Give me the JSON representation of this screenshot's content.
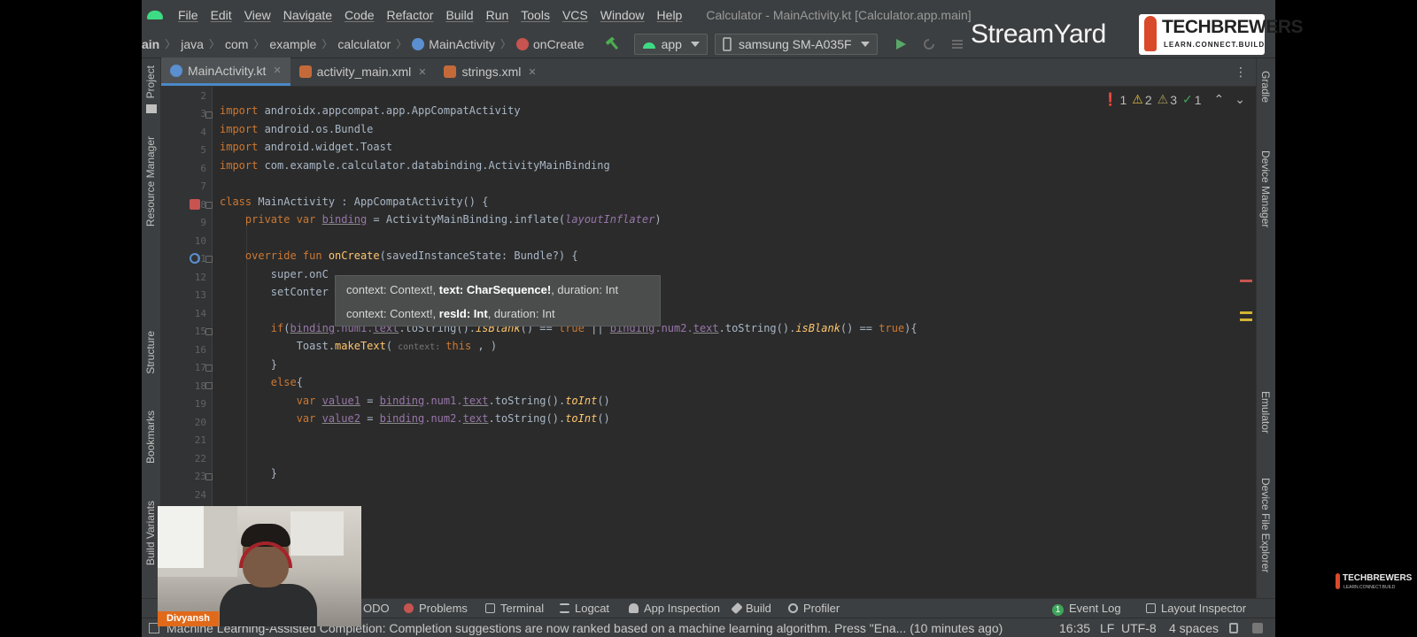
{
  "colors": {
    "ide_bg": "#2b2b2b",
    "toolbar": "#3c3f41",
    "keyword": "#cc7832",
    "function": "#ffc66d",
    "property": "#9876aa",
    "error": "#e05555",
    "warning": "#e8bf3a",
    "accent": "#4a88c7",
    "streamer_badge": "#e06a1a"
  },
  "menu": {
    "items": [
      "File",
      "Edit",
      "View",
      "Navigate",
      "Code",
      "Refactor",
      "Build",
      "Run",
      "Tools",
      "VCS",
      "Window",
      "Help"
    ],
    "window_title": "Calculator - MainActivity.kt [Calculator.app.main]"
  },
  "nav": {
    "breadcrumbs": [
      "ain",
      "java",
      "com",
      "example",
      "calculator",
      "MainActivity",
      "onCreate"
    ],
    "run_config": "app",
    "device": "samsung SM-A035F"
  },
  "tabs": [
    {
      "label": "MainActivity.kt",
      "icon": "kotlin-file-icon"
    },
    {
      "label": "activity_main.xml",
      "icon": "xml-layout-icon"
    },
    {
      "label": "strings.xml",
      "icon": "xml-values-icon"
    }
  ],
  "left_tool_windows": [
    "Project",
    "Resource Manager",
    "Structure",
    "Bookmarks",
    "Build Variants"
  ],
  "right_tool_windows": [
    "Gradle",
    "Device Manager",
    "Emulator",
    "Device File Explorer"
  ],
  "inspections": {
    "errors": "1",
    "warnings": "2",
    "weak_warnings": "3",
    "typos": "1"
  },
  "line_numbers": [
    "2",
    "3",
    "4",
    "5",
    "6",
    "7",
    "8",
    "9",
    "10",
    "11",
    "12",
    "13",
    "14",
    "15",
    "16",
    "17",
    "18",
    "19",
    "20",
    "21",
    "22",
    "23",
    "24"
  ],
  "code": {
    "l3_kw": "import",
    "l3_rest": " androidx.appcompat.app.AppCompatActivity",
    "l4_kw": "import",
    "l4_rest": " android.os.Bundle",
    "l5_kw": "import",
    "l5_rest": " android.widget.Toast",
    "l6_kw": "import",
    "l6_rest": " com.example.calculator.databinding.ActivityMainBinding",
    "l8_kw": "class",
    "l8_rest": " MainActivity : AppCompatActivity() {",
    "l9_kw": "    private var",
    "l9_var": "binding",
    "l9_rest": " = ActivityMainBinding.inflate(",
    "l9_it": "layoutInflater",
    "l9_end": ")",
    "l11_kw": "    override fun",
    "l11_fn": "onCreate",
    "l11_rest": "(savedInstanceState: Bundle?) {",
    "l12": "        super.onC",
    "l13": "        setConter",
    "l15_kw": "        if",
    "l15_a": "(",
    "l15_b": "binding",
    "l15_c": ".num1.",
    "l15_d": "text",
    "l15_e": ".toString().",
    "l15_f": "isBlank",
    "l15_g": "() == ",
    "l15_h": "true",
    "l15_i": " || ",
    "l15_j": "binding",
    "l15_k": ".num2.",
    "l15_l": "text",
    "l15_m": ".toString().",
    "l15_n": "isBlank",
    "l15_o": "() == ",
    "l15_p": "true",
    "l15_q": "){",
    "l16_a": "            Toast.",
    "l16_b": "makeText",
    "l16_c": "(",
    "l16_hint": " context: ",
    "l16_kw": "this",
    "l16_d": " , ",
    "l16_e": ")",
    "l17": "        }",
    "l18_kw": "        else",
    "l18_rest": "{",
    "l19_kw": "            var",
    "l19_var": "value1",
    "l19_a": " = ",
    "l19_b": "binding",
    "l19_c": ".num1.",
    "l19_d": "text",
    "l19_e": ".toString().",
    "l19_f": "toInt",
    "l19_g": "()",
    "l20_kw": "            var",
    "l20_var": "value2",
    "l20_a": " = ",
    "l20_b": "binding",
    "l20_c": ".num2.",
    "l20_d": "text",
    "l20_e": ".toString().",
    "l20_f": "toInt",
    "l20_g": "()",
    "l23": "        }"
  },
  "param_popup": {
    "line1_a": "context: Context!, ",
    "line1_b": "text: CharSequence!",
    "line1_c": ", duration: Int",
    "line2_a": "context: Context!, ",
    "line2_b": "resId: Int",
    "line2_c": ", duration: Int"
  },
  "webcam": {
    "name": "Divyansh"
  },
  "bottom_tools": {
    "todo": "ODO",
    "problems": "Problems",
    "terminal": "Terminal",
    "logcat": "Logcat",
    "app_inspection": "App Inspection",
    "build": "Build",
    "profiler": "Profiler",
    "event_log": "Event Log",
    "event_log_count": "1",
    "layout_inspector": "Layout Inspector"
  },
  "status": {
    "message": "Machine Learning-Assisted Completion: Completion suggestions are now ranked based on a machine learning algorithm. Press \"Ena... (10 minutes ago)",
    "time": "16:35",
    "line_sep": "LF",
    "encoding": "UTF-8",
    "indent": "4 spaces"
  },
  "overlay": {
    "streamyard": "StreamYard",
    "brand_name": "TECHBREWERS",
    "brand_tagline": "LEARN.CONNECT.BUILD"
  }
}
